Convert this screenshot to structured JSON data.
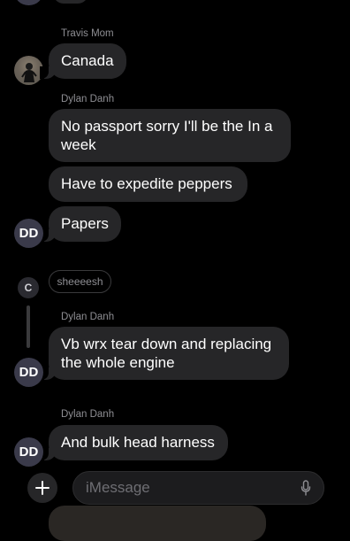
{
  "thread": {
    "msg1": {
      "sender": "Travis Mom",
      "text": "Canada"
    },
    "msg2": {
      "sender": "Dylan Danh",
      "texts": [
        "No passport sorry I'll be the In a week",
        "Have to expedite peppers",
        "Papers"
      ],
      "avatar_initials": "DD"
    },
    "reaction": {
      "avatar_initial": "C",
      "text": "sheeeesh"
    },
    "msg3": {
      "sender": "Dylan Danh",
      "text": "Vb wrx tear down and replacing the whole engine",
      "avatar_initials": "DD"
    },
    "msg4": {
      "sender": "Dylan Danh",
      "text": "And bulk head harness",
      "avatar_initials": "DD"
    }
  },
  "composer": {
    "placeholder": "iMessage",
    "add_icon": "plus-icon",
    "mic_icon": "microphone-icon"
  },
  "colors": {
    "background": "#000000",
    "bubble": "#262628",
    "secondary_text": "#8e8e93"
  }
}
